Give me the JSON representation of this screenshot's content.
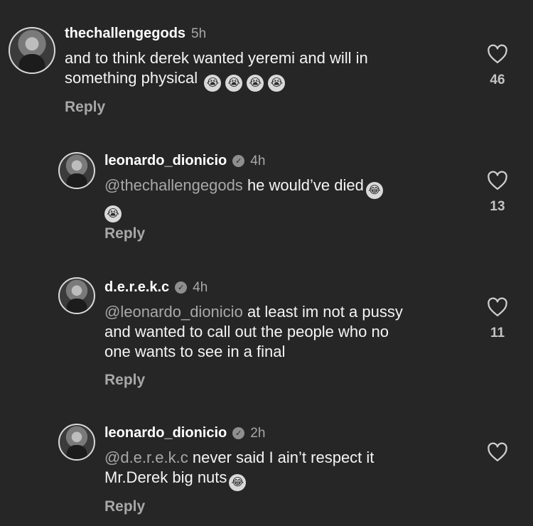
{
  "comments": [
    {
      "username": "thechallengegods",
      "verified": false,
      "time": "5h",
      "mention": "",
      "text_lines": [
        "and to think derek wanted yeremi and will in",
        "something physical"
      ],
      "emojis": [
        "loudly-crying-face",
        "loudly-crying-face",
        "loudly-crying-face",
        "loudly-crying-face"
      ],
      "reply_label": "Reply",
      "likes": "46"
    },
    {
      "username": "leonardo_dionicio",
      "verified": true,
      "time": "4h",
      "mention": "@thechallengegods",
      "text": "he would’ve died",
      "emojis": [
        "face-with-tears-of-joy",
        "loudly-crying-face"
      ],
      "reply_label": "Reply",
      "likes": "13"
    },
    {
      "username": "d.e.r.e.k.c",
      "verified": true,
      "time": "4h",
      "mention": "@leonardo_dionicio",
      "text_lines": [
        "at least im not a pussy",
        "and wanted to call out the people who no",
        "one wants to see in a final"
      ],
      "reply_label": "Reply",
      "likes": "11"
    },
    {
      "username": "leonardo_dionicio",
      "verified": true,
      "time": "2h",
      "mention": "@d.e.r.e.k.c",
      "text_lines": [
        "never said I ain’t respect it",
        "Mr.Derek big nuts"
      ],
      "emojis": [
        "face-with-tears-of-joy"
      ],
      "reply_label": "Reply",
      "likes": ""
    }
  ],
  "colors": {
    "background": "#262626",
    "muted": "#a8a8a8",
    "text": "#f4f4f4"
  }
}
